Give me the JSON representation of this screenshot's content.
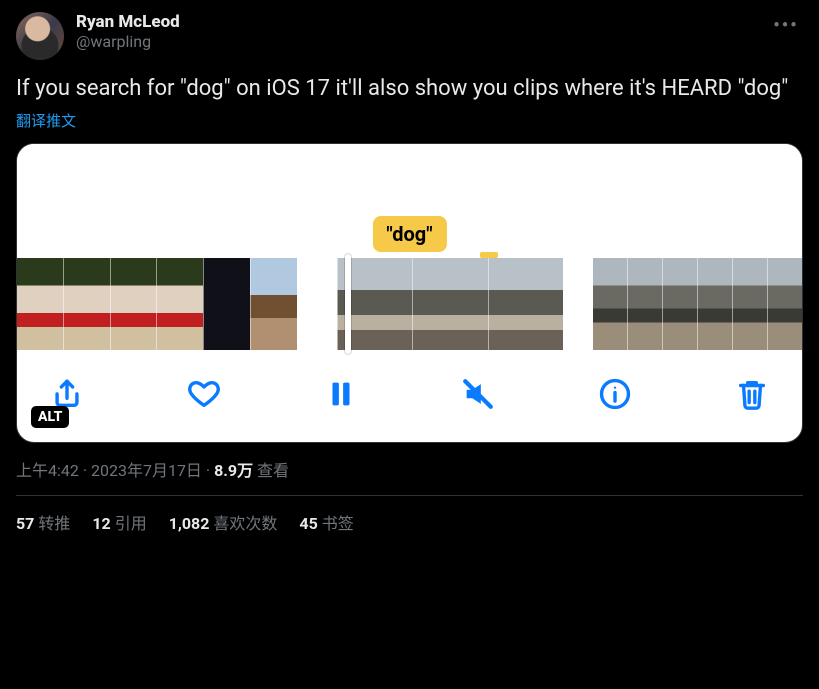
{
  "tweet": {
    "author": {
      "display_name": "Ryan McLeod",
      "handle": "@warpling"
    },
    "body_text": "If you search for \"dog\" on iOS 17 it'll also show you clips where it's HEARD \"dog\"",
    "translate_label": "翻译推文",
    "media": {
      "caption_label": "\"dog\"",
      "alt_badge": "ALT"
    },
    "meta": {
      "time": "上午4:42",
      "date": "2023年7月17日",
      "separator": " · ",
      "views_number": "8.9万",
      "views_label": " 查看"
    },
    "stats": {
      "retweets": {
        "count": "57",
        "label": "转推"
      },
      "quotes": {
        "count": "12",
        "label": "引用"
      },
      "likes": {
        "count": "1,082",
        "label": "喜欢次数"
      },
      "bookmarks": {
        "count": "45",
        "label": "书签"
      }
    }
  }
}
